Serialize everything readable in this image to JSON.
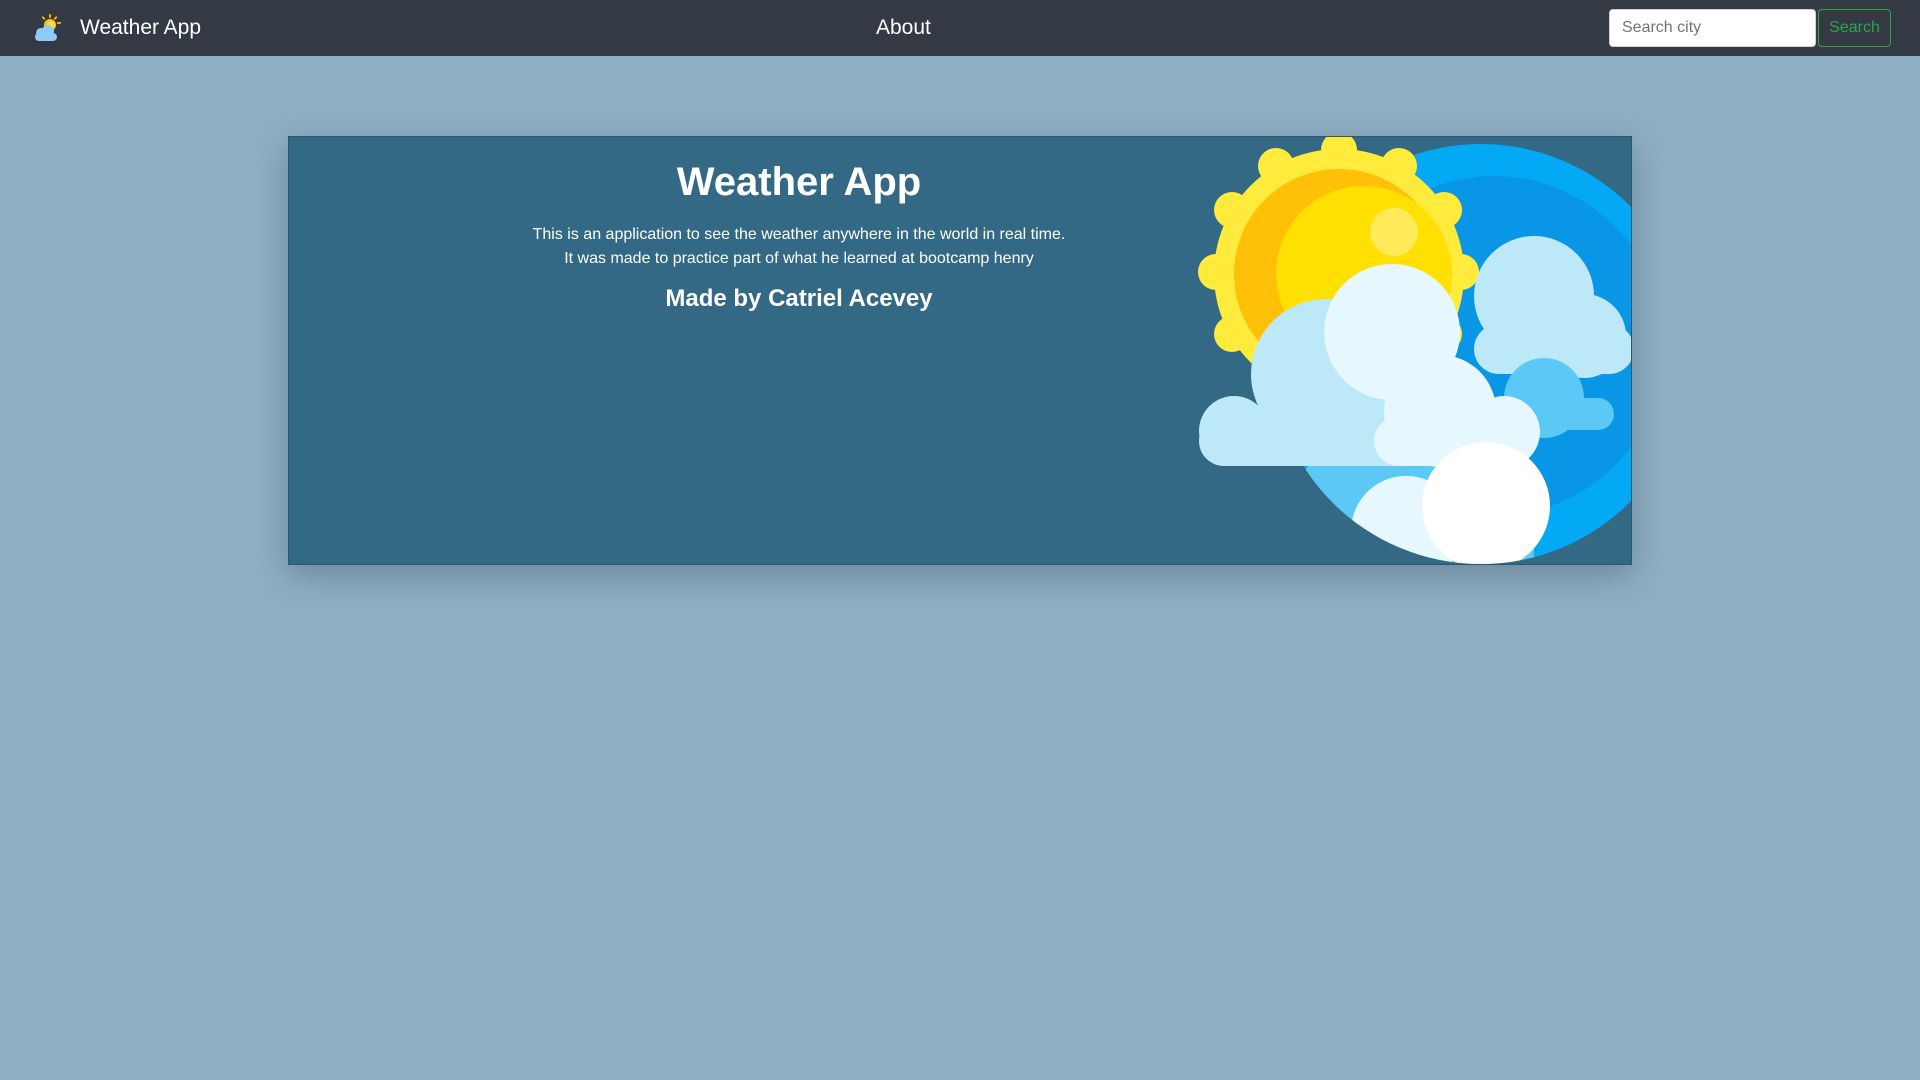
{
  "navbar": {
    "brand_label": "Weather App",
    "brand_icon": "sun-cloud-icon",
    "about_label": "About",
    "search": {
      "placeholder": "Search city",
      "value": "",
      "button_label": "Search"
    }
  },
  "card": {
    "title": "Weather App",
    "description_line1": "This is an application to see the weather anywhere in the world in real time.",
    "description_line2": "It was made to practice part of what he learned at bootcamp henry",
    "author": "Made by Catriel Acevey",
    "illustration_icon": "sun-clouds-illustration"
  },
  "colors": {
    "page_background": "#8fafc3",
    "navbar_background": "#343a44",
    "card_background": "#336984",
    "search_button_accent": "#28a745",
    "sky_blue": "#03a9f4",
    "sun_yellow": "#ffeb3b"
  }
}
